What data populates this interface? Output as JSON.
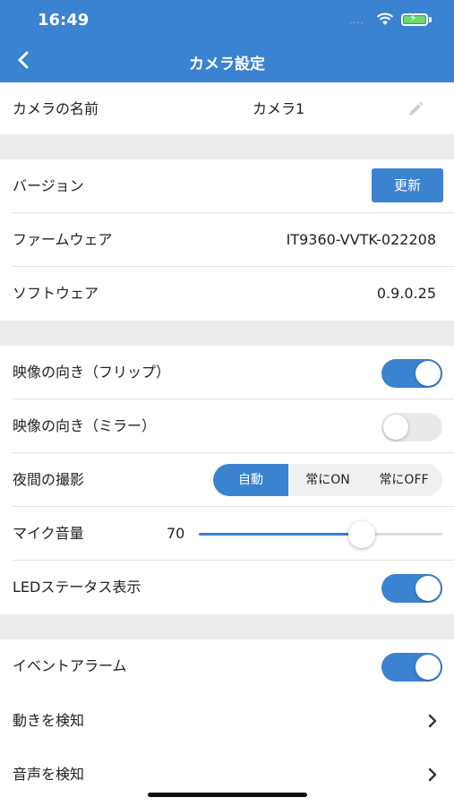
{
  "status_bar": {
    "time": "16:49",
    "signal": "...."
  },
  "nav": {
    "title": "カメラ設定"
  },
  "camera_name": {
    "label": "カメラの名前",
    "value": "カメラ1"
  },
  "version": {
    "label": "バージョン",
    "update_label": "更新"
  },
  "firmware": {
    "label": "ファームウェア",
    "value": "IT9360-VVTK-022208"
  },
  "software": {
    "label": "ソフトウェア",
    "value": "0.9.0.25"
  },
  "flip": {
    "label": "映像の向き（フリップ）",
    "on": true
  },
  "mirror": {
    "label": "映像の向き（ミラー）",
    "on": false
  },
  "night": {
    "label": "夜間の撮影",
    "options": [
      "自動",
      "常にON",
      "常にOFF"
    ],
    "selected": "自動"
  },
  "mic": {
    "label": "マイク音量",
    "value": "70",
    "level": 0.67
  },
  "led": {
    "label": "LEDステータス表示",
    "on": true
  },
  "event_alarm": {
    "label": "イベントアラーム",
    "on": true
  },
  "motion": {
    "label": "動きを検知"
  },
  "sound": {
    "label": "音声を検知"
  },
  "colors": {
    "accent": "#3b82d1",
    "separator": "#ececec"
  }
}
